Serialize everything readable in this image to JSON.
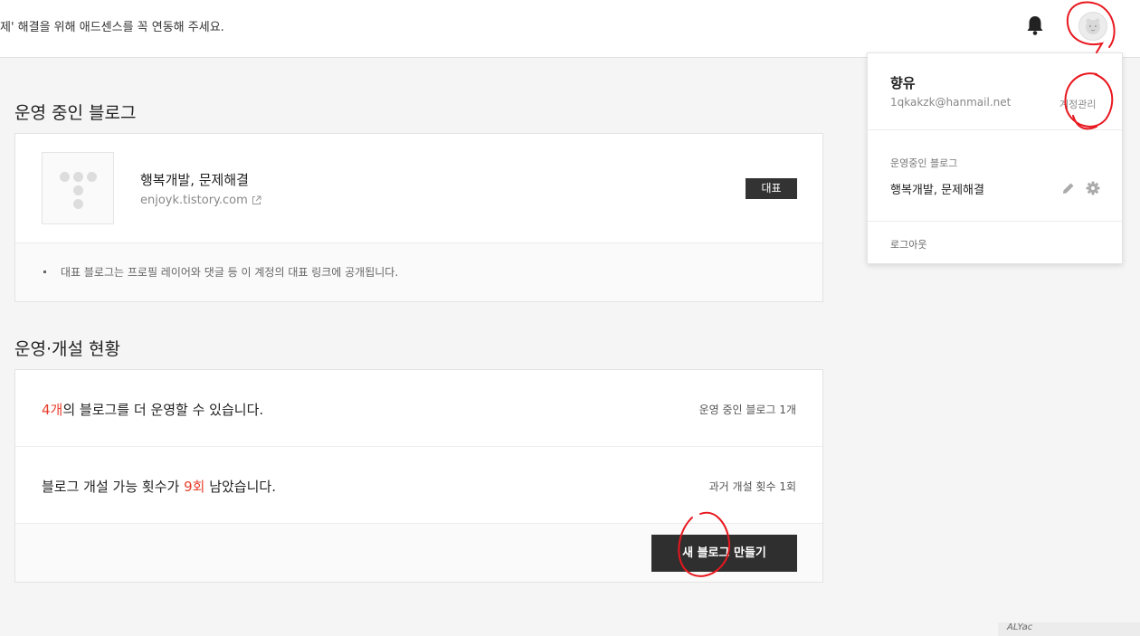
{
  "topbar": {
    "notice": "제' 해결을 위해 애드센스를 꼭 연동해 주세요.",
    "bell_icon": "bell-icon",
    "avatar_icon": "avatar-icon"
  },
  "running_blogs": {
    "title": "운영 중인 블로그",
    "blog": {
      "name": "행복개발, 문제해결",
      "url": "enjoyk.tistory.com",
      "badge": "대표"
    },
    "note": "대표 블로그는 프로필 레이어와 댓글 등 이 계정의 대표 링크에 공개됩니다."
  },
  "status": {
    "title": "운영·개설 현황",
    "row1": {
      "count": "4개",
      "text": "의 블로그를 더 운영할 수 있습니다.",
      "side": "운영 중인 블로그 1개"
    },
    "row2": {
      "prefix": "블로그 개설 가능 횟수가 ",
      "count": "9회",
      "suffix": " 남았습니다.",
      "side": "과거 개설 횟수 1회"
    },
    "create_button": "새 블로그 만들기"
  },
  "dropdown": {
    "name": "향유",
    "email": "1qkakzk@hanmail.net",
    "account_link": "계정관리",
    "running_label": "운영중인 블로그",
    "blog_name": "행복개발, 문제해결",
    "logout": "로그아웃"
  },
  "corner_label": "ALYac",
  "colors": {
    "accent_red": "#e7402f",
    "dark_button": "#2f2f2f",
    "annotation_red": "#e8181f"
  }
}
